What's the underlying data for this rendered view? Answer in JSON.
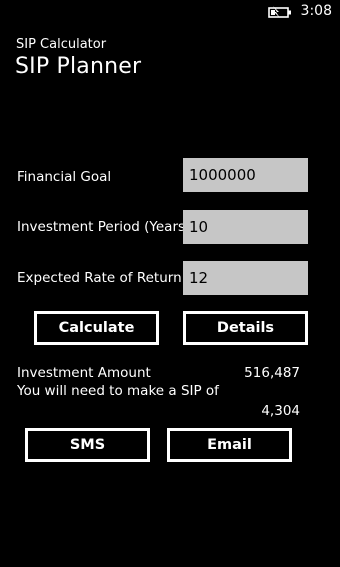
{
  "status_bar": {
    "time": "3:08",
    "battery_icon": "battery-charging-icon"
  },
  "header": {
    "app_title": "SIP Calculator",
    "page_title": "SIP Planner"
  },
  "form": {
    "financial_goal": {
      "label": "Financial Goal",
      "value": "1000000"
    },
    "investment_period": {
      "label": "Investment Period (Years)",
      "value": "10"
    },
    "expected_return": {
      "label": "Expected Rate of Return",
      "value": "12"
    }
  },
  "actions": {
    "calculate_label": "Calculate",
    "details_label": "Details",
    "sms_label": "SMS",
    "email_label": "Email"
  },
  "results": {
    "investment_amount_label": "Investment Amount",
    "investment_amount_value": "516,487",
    "sip_label": "You will need to make a SIP of",
    "sip_value": "4,304"
  },
  "colors": {
    "background": "#000000",
    "foreground": "#ffffff",
    "input_background": "#c6c6c6"
  }
}
